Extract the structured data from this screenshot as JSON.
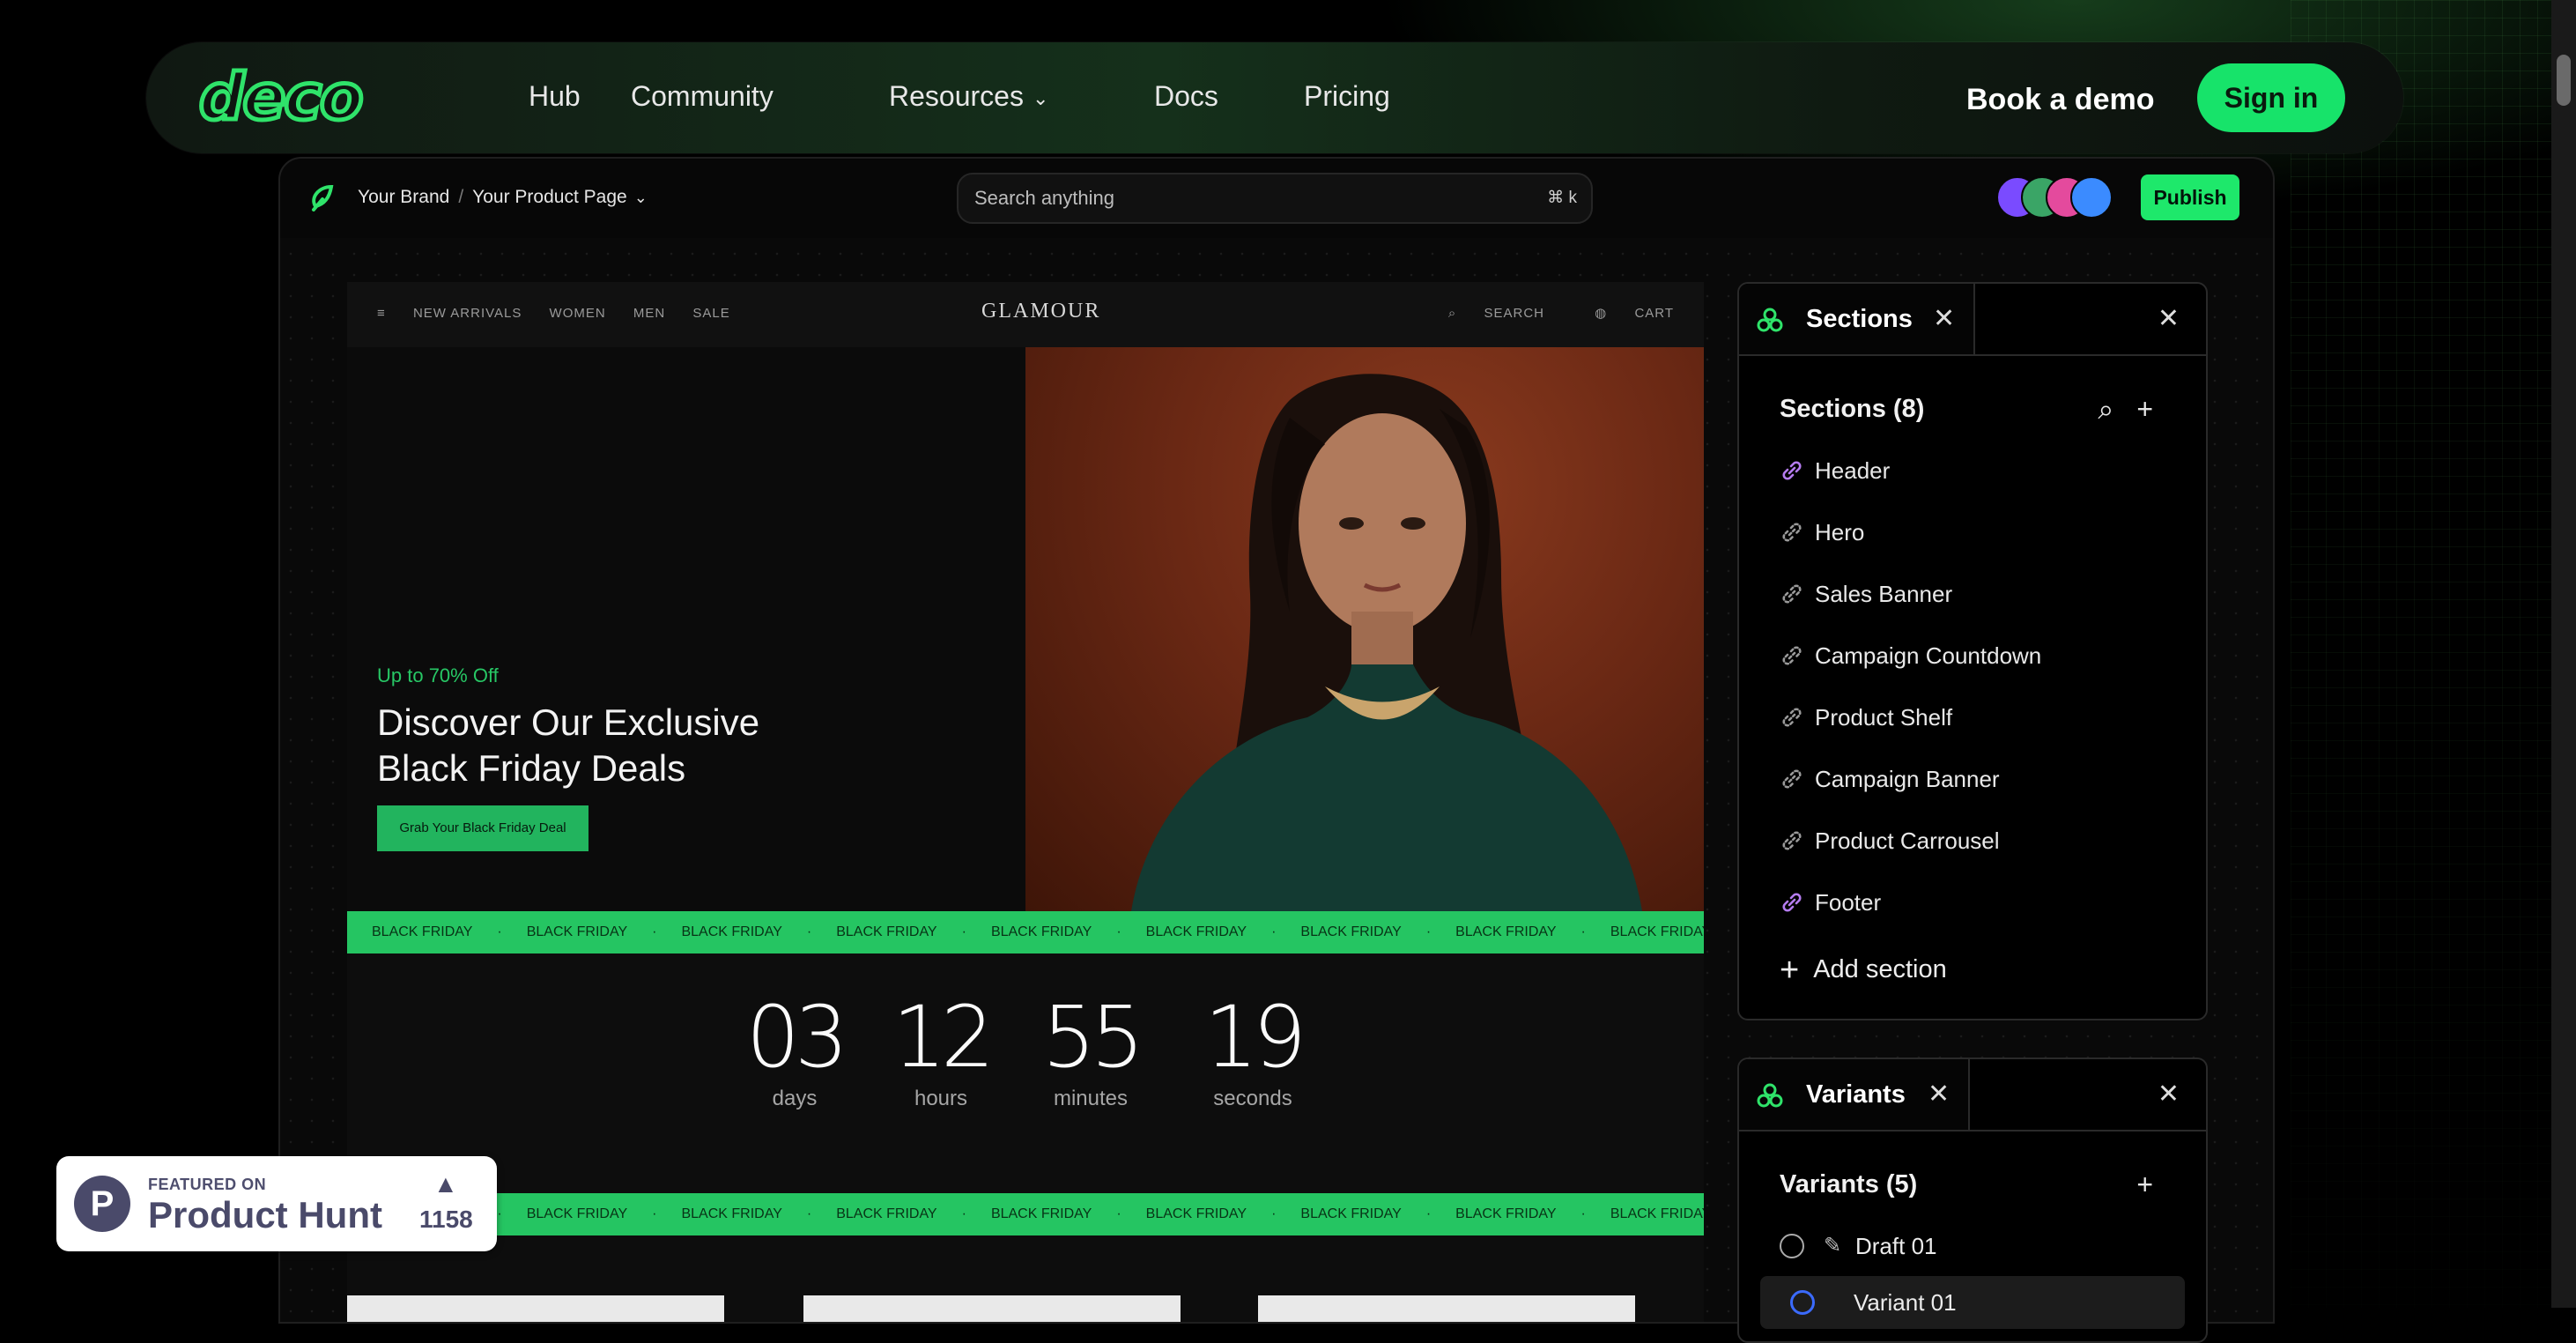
{
  "nav": {
    "logo": "deco",
    "links": [
      "Hub",
      "Community",
      "Resources",
      "Docs",
      "Pricing"
    ],
    "demo": "Book a demo",
    "signin": "Sign in"
  },
  "editor": {
    "breadcrumb_brand": "Your Brand",
    "breadcrumb_sep": "/",
    "breadcrumb_page": "Your Product Page",
    "search_placeholder": "Search anything",
    "search_shortcut": "⌘ k",
    "publish": "Publish",
    "avatar_colors": [
      "#7a4bff",
      "#3aa566",
      "#e44a9d",
      "#3b8bff"
    ]
  },
  "store": {
    "menu": [
      "NEW ARRIVALS",
      "WOMEN",
      "MEN",
      "SALE"
    ],
    "brand": "GLAMOUR",
    "search": "SEARCH",
    "cart": "CART",
    "promo": "Up to 70% Off",
    "title": "Discover Our Exclusive Black Friday Deals",
    "cta": "Grab Your Black Friday Deal",
    "ticker_text": "BLACK FRIDAY",
    "countdown": [
      {
        "value": "03",
        "label": "days"
      },
      {
        "value": "12",
        "label": "hours"
      },
      {
        "value": "55",
        "label": "minutes"
      },
      {
        "value": "19",
        "label": "seconds"
      }
    ]
  },
  "sections_panel": {
    "tab": "Sections",
    "heading": "Sections (8)",
    "items": [
      {
        "label": "Header",
        "linked": true
      },
      {
        "label": "Hero",
        "linked": false
      },
      {
        "label": "Sales Banner",
        "linked": false
      },
      {
        "label": "Campaign Countdown",
        "linked": false
      },
      {
        "label": "Product Shelf",
        "linked": false
      },
      {
        "label": "Campaign Banner",
        "linked": false
      },
      {
        "label": "Product Carrousel",
        "linked": false
      },
      {
        "label": "Footer",
        "linked": true
      }
    ],
    "add": "Add section"
  },
  "variants_panel": {
    "tab": "Variants",
    "heading": "Variants (5)",
    "items": [
      {
        "label": "Draft 01"
      },
      {
        "label": "Variant 01"
      }
    ]
  },
  "product_hunt": {
    "featured": "FEATURED ON",
    "name": "Product Hunt",
    "count": "1158"
  },
  "colors": {
    "accent": "#17e36a",
    "link_icon_linked": "#b57cf0",
    "link_icon_unlinked": "#9a9a9a"
  }
}
